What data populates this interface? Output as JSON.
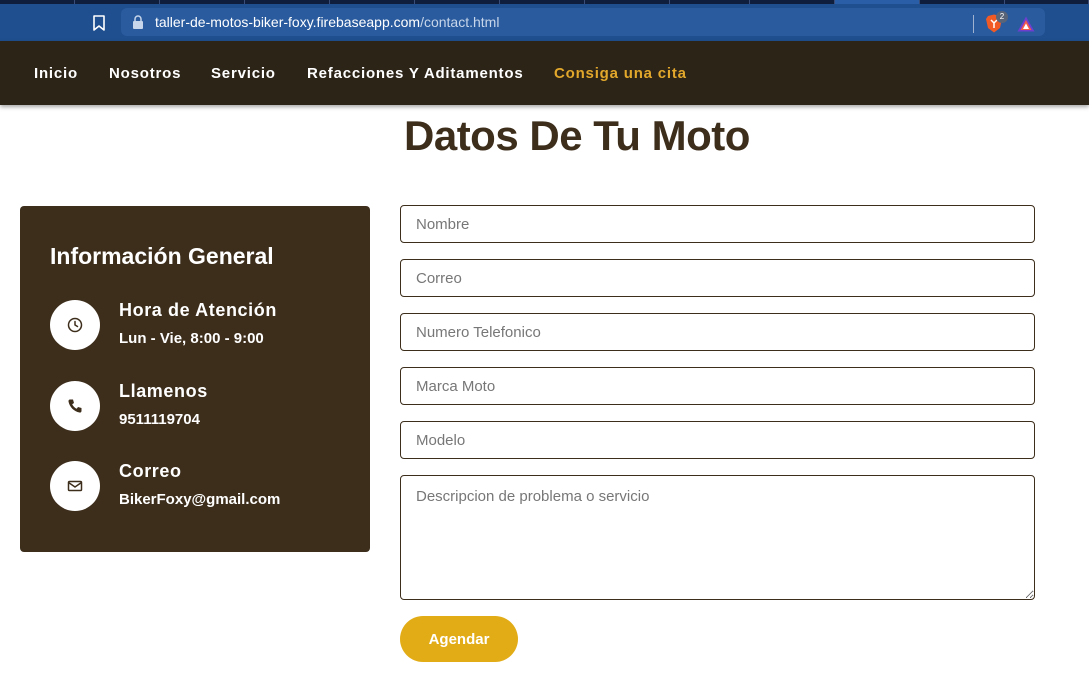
{
  "browser": {
    "url_host": "taller-de-motos-biker-foxy.firebaseapp.com",
    "url_path": "/contact.html",
    "shields_badge": "2"
  },
  "nav": {
    "items": [
      {
        "label": "Inicio"
      },
      {
        "label": "Nosotros"
      },
      {
        "label": "Servicio"
      },
      {
        "label": "Refacciones Y Aditamentos"
      },
      {
        "label": "Consiga una cita"
      }
    ]
  },
  "page": {
    "title": "Datos De Tu Moto"
  },
  "info": {
    "title": "Información General",
    "rows": [
      {
        "label": "Hora de Atención",
        "value": "Lun - Vie, 8:00 - 9:00",
        "icon": "clock-icon"
      },
      {
        "label": "Llamenos",
        "value": "9511119704",
        "icon": "phone-icon"
      },
      {
        "label": "Correo",
        "value": "BikerFoxy@gmail.com",
        "icon": "envelope-icon"
      }
    ]
  },
  "form": {
    "name_placeholder": "Nombre",
    "email_placeholder": "Correo",
    "phone_placeholder": "Numero Telefonico",
    "brand_placeholder": "Marca Moto",
    "model_placeholder": "Modelo",
    "description_placeholder": "Descripcion de problema o servicio",
    "submit_label": "Agendar"
  },
  "colors": {
    "nav_background": "#2d2418",
    "active_nav": "#e2a82b",
    "card_background": "#3d2e1c",
    "button": "#e2ac17"
  }
}
